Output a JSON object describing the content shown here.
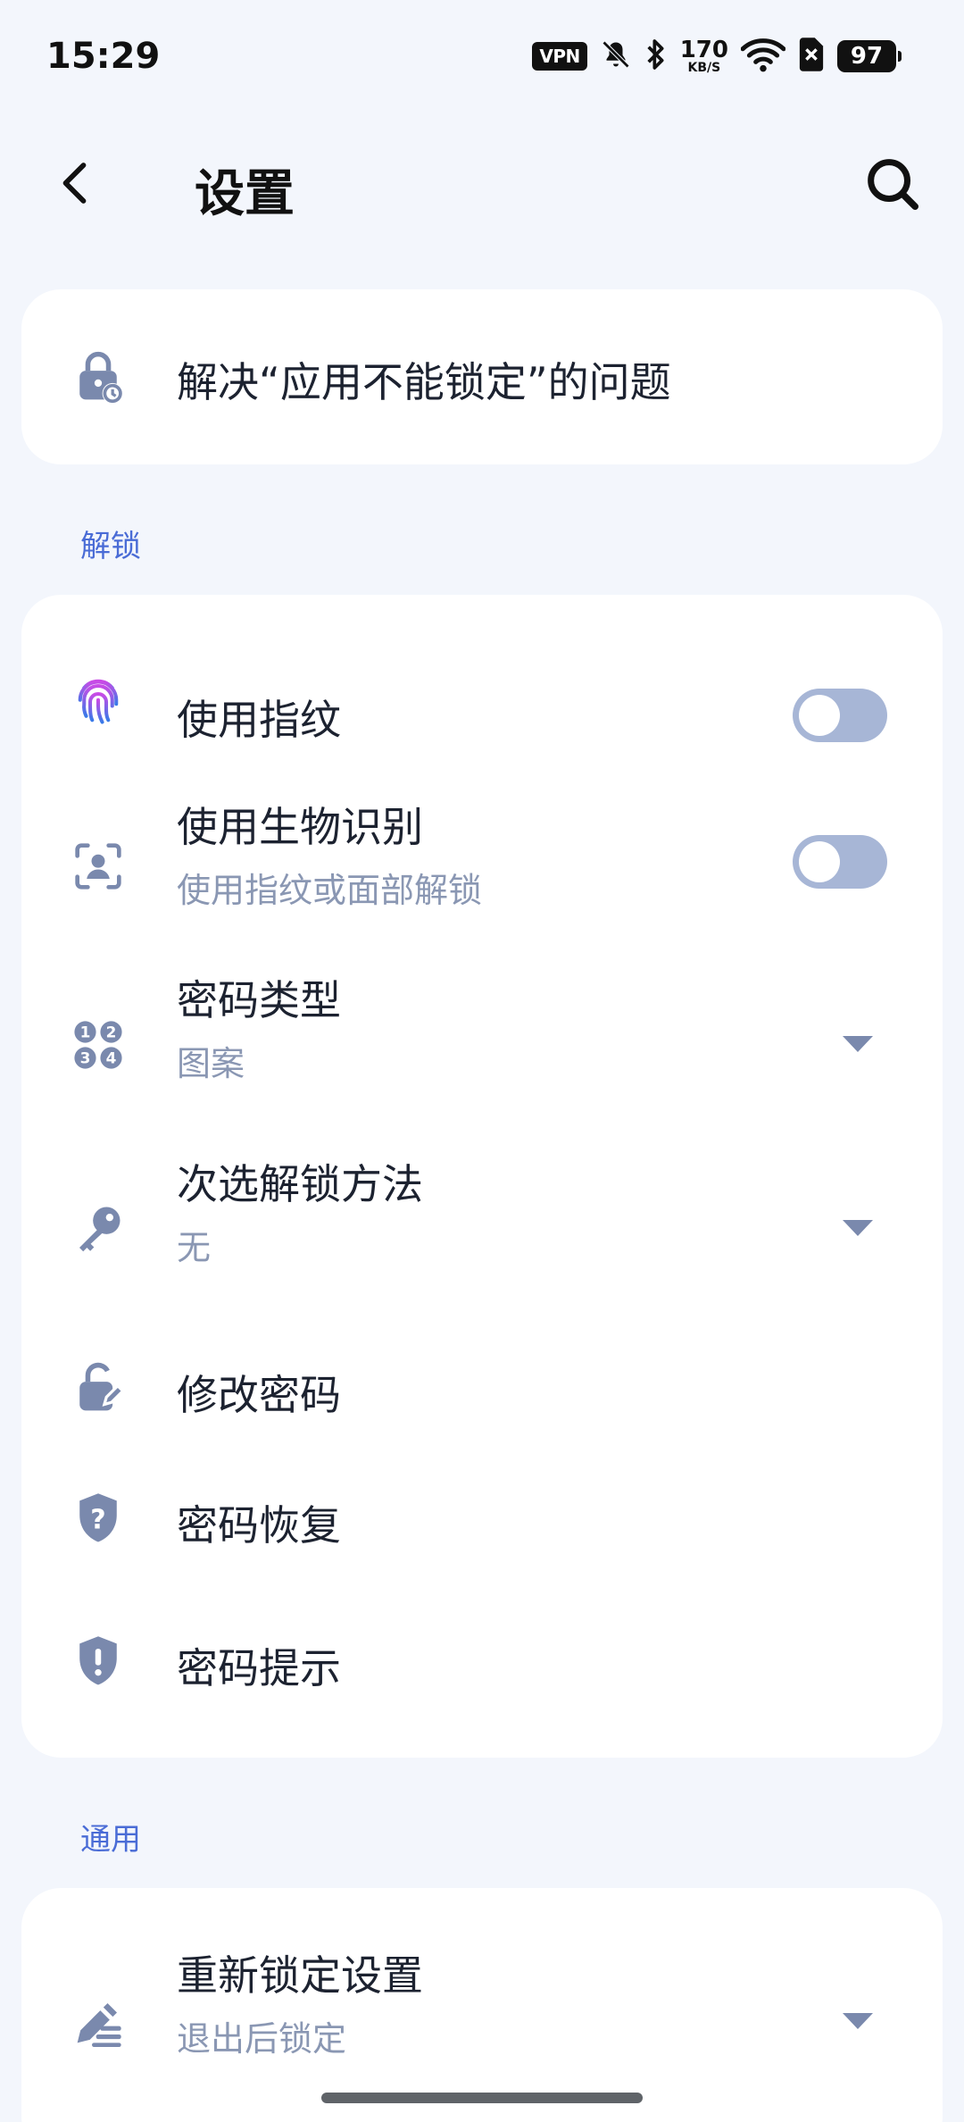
{
  "status_bar": {
    "time": "15:29",
    "vpn": "VPN",
    "net_speed_value": "170",
    "net_speed_unit": "KB/S",
    "battery": "97"
  },
  "header": {
    "title": "设置"
  },
  "top_card": {
    "title": "解决“应用不能锁定”的问题"
  },
  "sections": {
    "unlock_label": "解锁",
    "general_label": "通用"
  },
  "unlock": {
    "fingerprint_title": "使用指纹",
    "fingerprint_enabled": false,
    "biometric_title": "使用生物识别",
    "biometric_sub": "使用指纹或面部解锁",
    "biometric_enabled": false,
    "password_type_title": "密码类型",
    "password_type_value": "图案",
    "secondary_title": "次选解锁方法",
    "secondary_value": "无",
    "change_password": "修改密码",
    "password_recovery": "密码恢复",
    "password_hint": "密码提示"
  },
  "general": {
    "relock_title": "重新锁定设置",
    "relock_value": "退出后锁定"
  },
  "colors": {
    "accent": "#4a6cd6",
    "icon": "#7a89ad",
    "toggle_off": "#a7b6d6",
    "background": "#f3f6fc"
  }
}
